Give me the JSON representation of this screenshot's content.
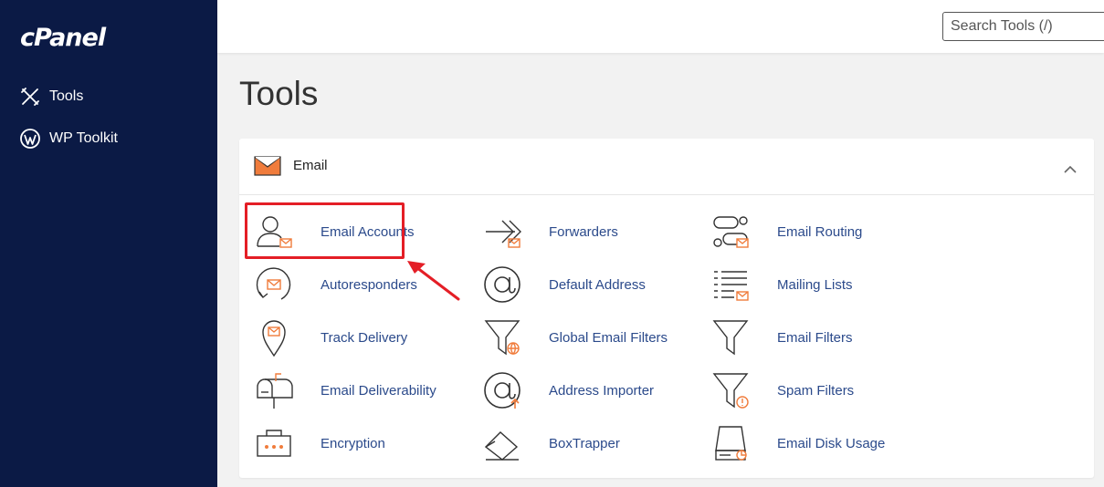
{
  "sidebar": {
    "logo": "cPanel",
    "items": [
      {
        "label": "Tools"
      },
      {
        "label": "WP Toolkit"
      }
    ]
  },
  "search": {
    "placeholder": "Search Tools (/)"
  },
  "main": {
    "title": "Tools",
    "section": {
      "title": "Email",
      "tools": [
        {
          "label": "Email Accounts",
          "icon": "email-accounts-icon"
        },
        {
          "label": "Forwarders",
          "icon": "forwarders-icon"
        },
        {
          "label": "Email Routing",
          "icon": "email-routing-icon"
        },
        {
          "label": "Autoresponders",
          "icon": "autoresponders-icon"
        },
        {
          "label": "Default Address",
          "icon": "at-sign-icon"
        },
        {
          "label": "Mailing Lists",
          "icon": "mailing-lists-icon"
        },
        {
          "label": "Track Delivery",
          "icon": "location-pin-icon"
        },
        {
          "label": "Global Email Filters",
          "icon": "global-filter-icon"
        },
        {
          "label": "Email Filters",
          "icon": "filter-icon"
        },
        {
          "label": "Email Deliverability",
          "icon": "mailbox-icon"
        },
        {
          "label": "Address Importer",
          "icon": "address-importer-icon"
        },
        {
          "label": "Spam Filters",
          "icon": "spam-filter-icon"
        },
        {
          "label": "Encryption",
          "icon": "encryption-icon"
        },
        {
          "label": "BoxTrapper",
          "icon": "boxtrapper-icon"
        },
        {
          "label": "Email Disk Usage",
          "icon": "disk-usage-icon"
        }
      ]
    }
  },
  "colors": {
    "sidebar_bg": "#0b1a45",
    "link": "#2b4a8b",
    "accent_orange": "#f07c3c",
    "highlight_red": "#e41e26"
  }
}
